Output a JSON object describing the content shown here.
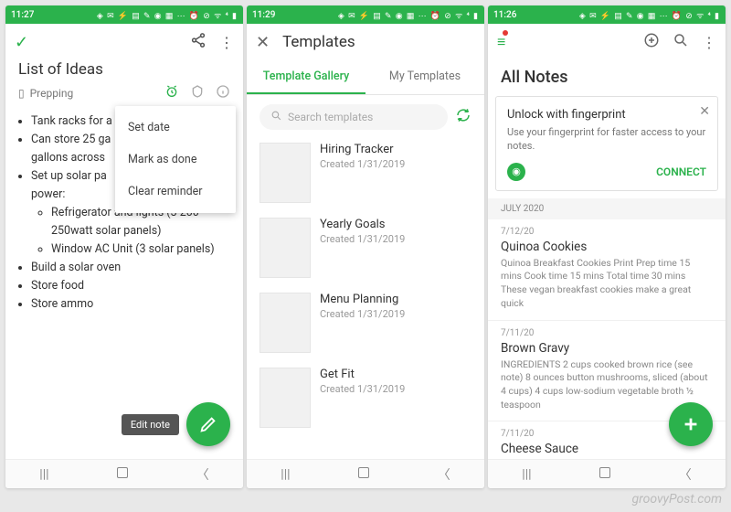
{
  "status": {
    "time1": "11:27",
    "time2": "11:29",
    "time3": "11:26",
    "icons": "◈ ✉ ⚡ ▤ ✎ ◉ ▦ ⋯  ⏰ ⊘ ᯤ ⁴ ▮"
  },
  "p1": {
    "title": "List of Ideas",
    "notebook": "Prepping",
    "menu": {
      "set_date": "Set date",
      "mark_done": "Mark as done",
      "clear": "Clear reminder"
    },
    "bullets": {
      "b1": "Tank racks for a",
      "b2": "Can store 25 ga",
      "b2b": "gallons across",
      "b3": "Set up solar pa",
      "b3b": "power:",
      "s1": "Refrigerator and lights (3 200-250watt solar panels)",
      "s2": "Window AC Unit (3 solar panels)",
      "b4": "Build a solar oven",
      "b5": "Store food",
      "b6": "Store ammo"
    },
    "tooltip": "Edit note"
  },
  "p2": {
    "title": "Templates",
    "tab_gallery": "Template Gallery",
    "tab_my": "My Templates",
    "search_placeholder": "Search templates",
    "templates": [
      {
        "name": "Hiring Tracker",
        "created": "Created 1/31/2019"
      },
      {
        "name": "Yearly Goals",
        "created": "Created 1/31/2019"
      },
      {
        "name": "Menu Planning",
        "created": "Created 1/31/2019"
      },
      {
        "name": "Get Fit",
        "created": "Created 1/31/2019"
      }
    ]
  },
  "p3": {
    "title": "All Notes",
    "card": {
      "title": "Unlock with fingerprint",
      "sub": "Use your fingerprint for faster access to your notes.",
      "connect": "CONNECT"
    },
    "section": "JULY 2020",
    "notes": [
      {
        "date": "7/12/20",
        "title": "Quinoa Cookies",
        "body": "Quinoa Breakfast Cookies   Print Prep time 15 mins Cook time 15 mins Total time 30 mins   These vegan breakfast cookies make a great quick"
      },
      {
        "date": "7/11/20",
        "title": "Brown Gravy",
        "body": "INGREDIENTS 2 cups cooked brown rice (see note) 8 ounces button mushrooms, sliced (about 4 cups) 4 cups low-sodium vegetable broth ½ teaspoon"
      },
      {
        "date": "7/11/20",
        "title": "Cheese Sauce",
        "body": ""
      }
    ]
  },
  "watermark": "groovyPost.com"
}
